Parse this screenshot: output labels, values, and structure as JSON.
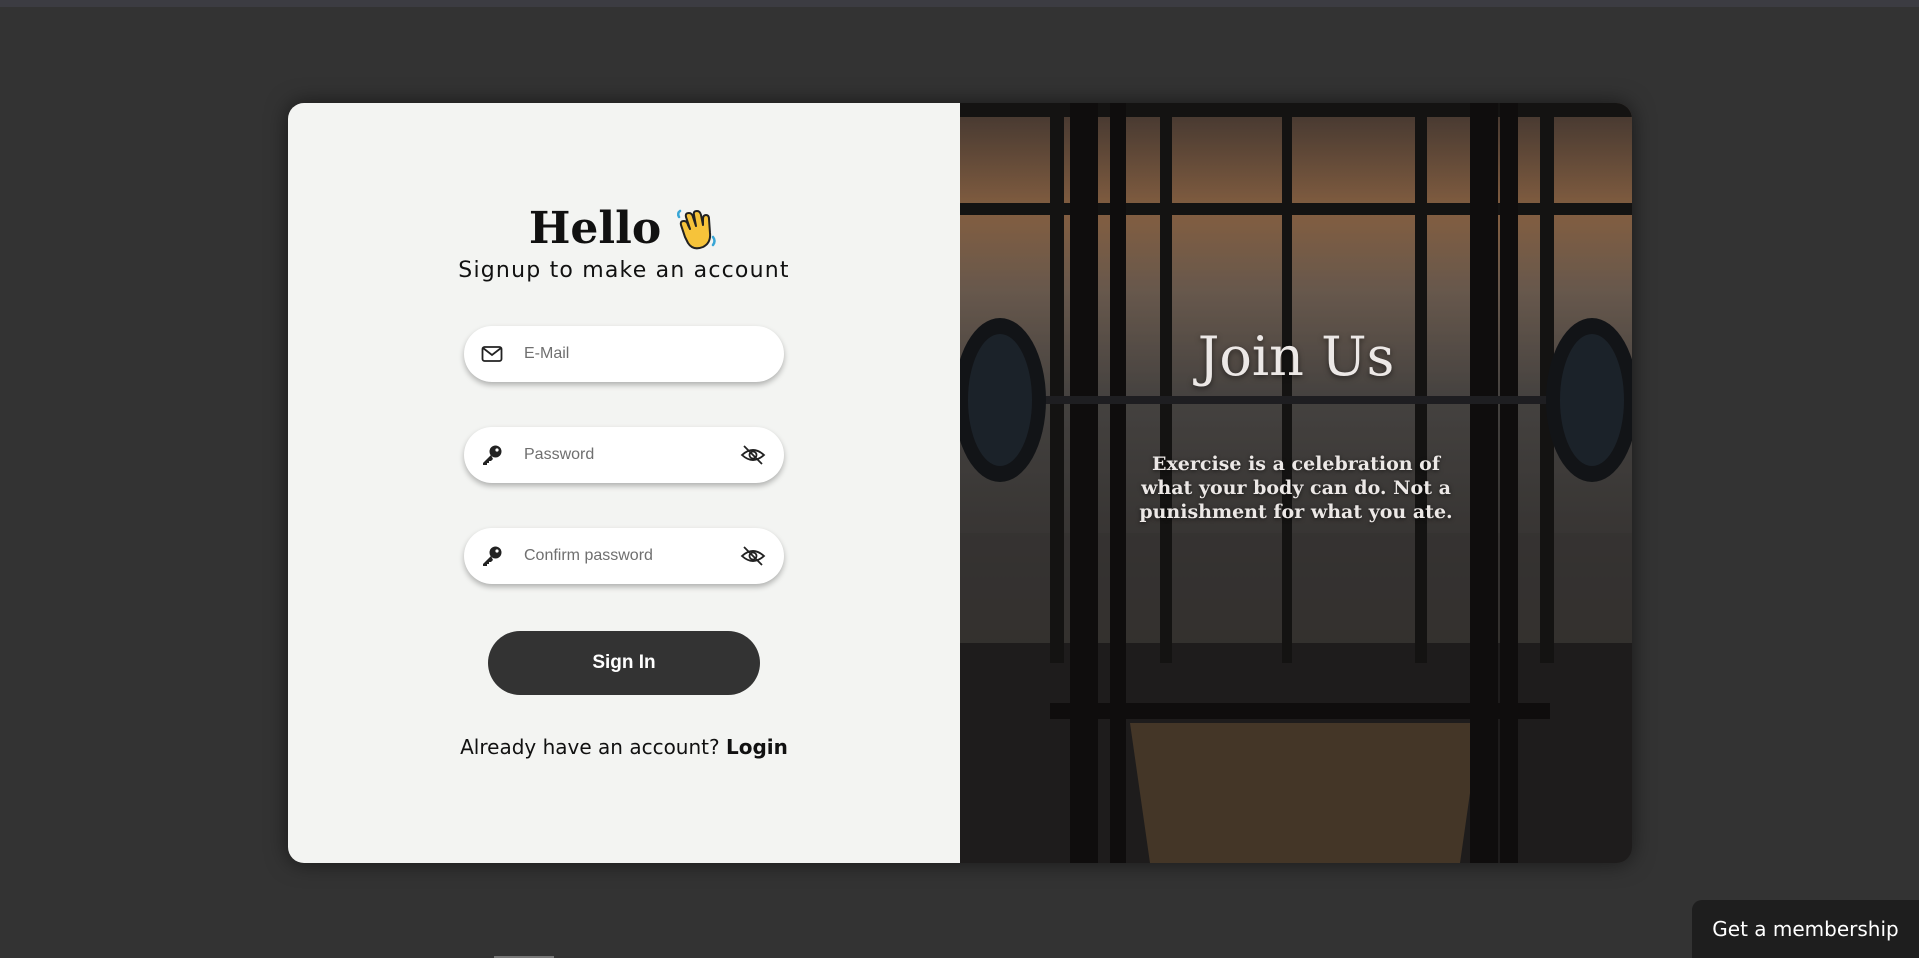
{
  "left": {
    "hello": "Hello",
    "subtitle": "Signup to make an account",
    "email_placeholder": "E-Mail",
    "password_placeholder": "Password",
    "confirm_placeholder": "Confirm password",
    "signin_label": "Sign In",
    "already_text": "Already have an account? ",
    "login_link": "Login"
  },
  "right": {
    "heading": "Join Us",
    "quote": "Exercise is a celebration of what your body can do. Not a punishment for what you ate."
  },
  "membership_button": "Get a membership",
  "colors": {
    "background": "#333333",
    "panel": "#f3f4f2",
    "button": "#333333",
    "membership": "#1e1e1e"
  },
  "icons": [
    "envelope-icon",
    "key-icon",
    "eye-slash-icon",
    "waving-hand-icon"
  ]
}
